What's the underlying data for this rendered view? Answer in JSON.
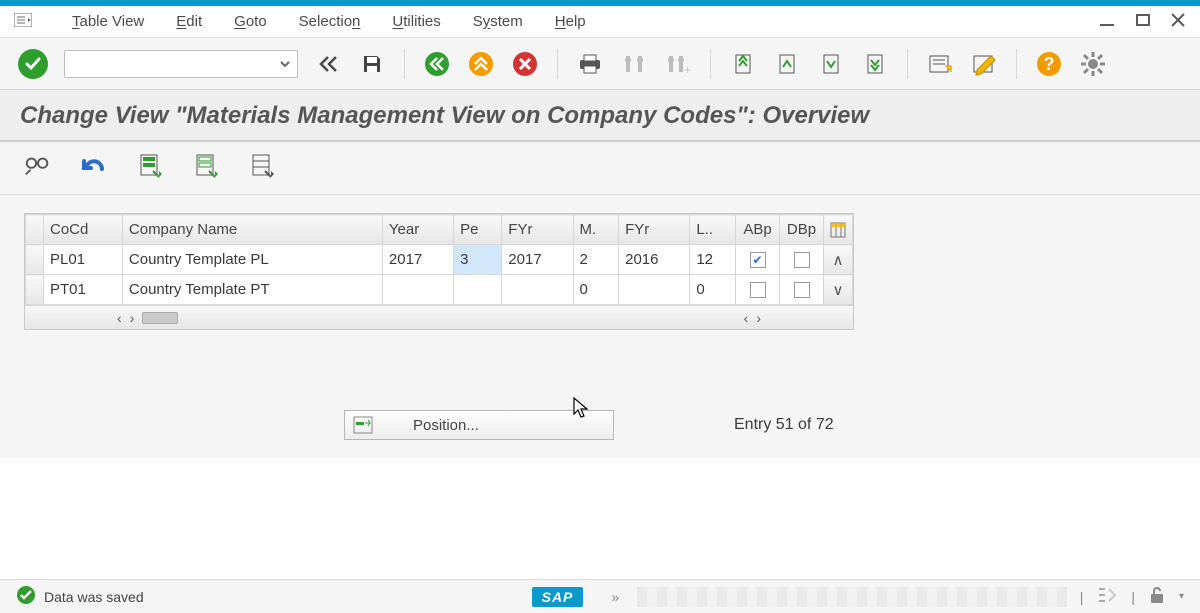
{
  "menu": {
    "items": [
      "Table View",
      "Edit",
      "Goto",
      "Selection",
      "Utilities",
      "System",
      "Help"
    ]
  },
  "title": "Change View \"Materials Management View on Company Codes\": Overview",
  "table": {
    "headers": {
      "cocd": "CoCd",
      "name": "Company Name",
      "year": "Year",
      "pe": "Pe",
      "fyr1": "FYr",
      "m": "M.",
      "fyr2": "FYr",
      "l": "L..",
      "abp": "ABp",
      "dbp": "DBp"
    },
    "rows": [
      {
        "cocd": "PL01",
        "name": "Country Template PL",
        "year": "2017",
        "pe": "3",
        "fyr1": "2017",
        "m": "2",
        "fyr2": "2016",
        "l": "12",
        "abp": true,
        "dbp": false
      },
      {
        "cocd": "PT01",
        "name": "Country Template PT",
        "year": "",
        "pe": "",
        "fyr1": "",
        "m": "0",
        "fyr2": "",
        "l": "0",
        "abp": false,
        "dbp": false
      }
    ]
  },
  "position_label": "Position...",
  "entry_text": "Entry 51 of 72",
  "status_msg": "Data was saved",
  "sap_logo": "SAP",
  "chevrons": "»"
}
